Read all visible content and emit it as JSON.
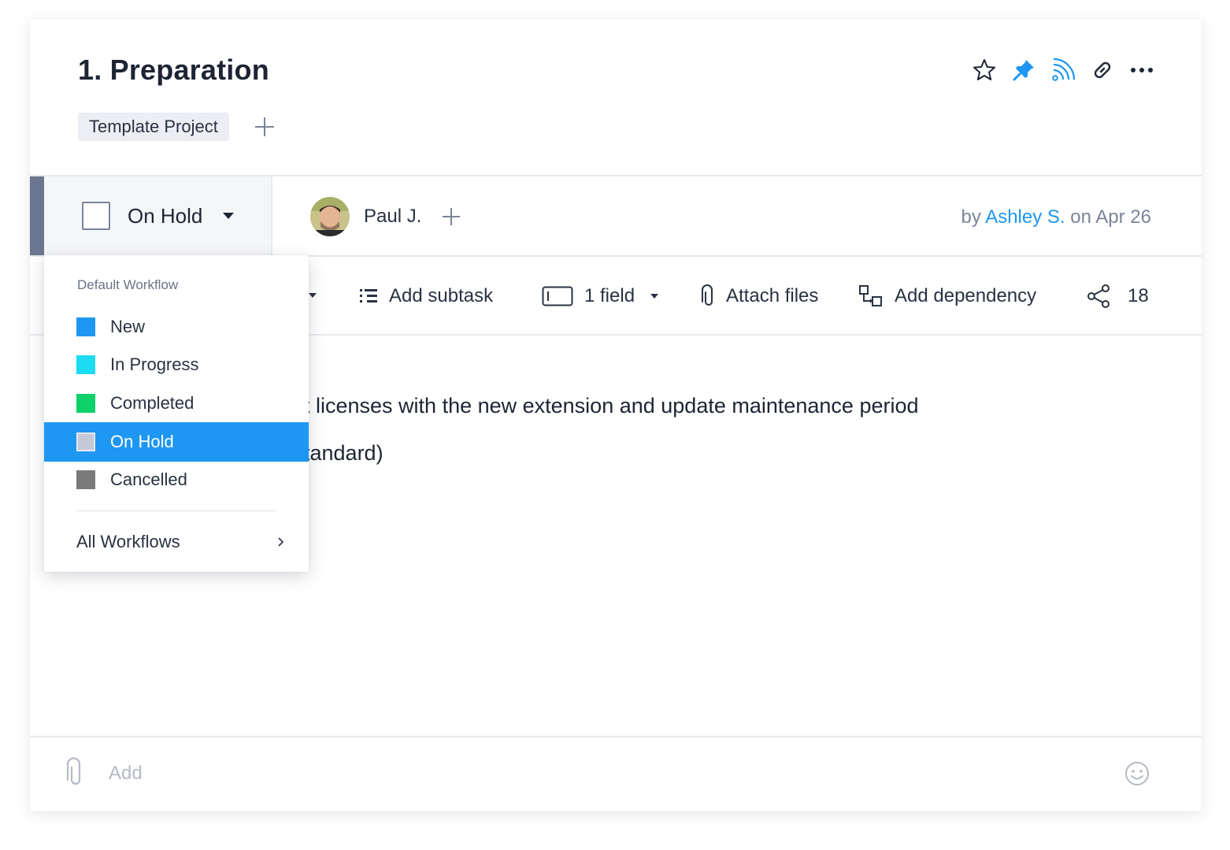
{
  "task": {
    "title": "1. Preparation",
    "tag": "Template Project"
  },
  "status": {
    "label": "On Hold",
    "bar_color": "#6b7790"
  },
  "assignee": {
    "name": "Paul J."
  },
  "byline": {
    "prefix": "by",
    "author": "Ashley S.",
    "date_text": "on Apr 26"
  },
  "toolbar": {
    "add_subtask": "Add subtask",
    "field": "1 field",
    "attach": "Attach files",
    "dependency": "Add dependency",
    "share_count": "18"
  },
  "description": {
    "line1": "t licenses with the new extension and update maintenance period",
    "line2": "tandard)"
  },
  "comment": {
    "placeholder": "Add"
  },
  "dropdown": {
    "heading": "Default Workflow",
    "items": [
      {
        "label": "New",
        "color": "#1e97f3",
        "active": false
      },
      {
        "label": "In Progress",
        "color": "#1ddcf2",
        "active": false
      },
      {
        "label": "Completed",
        "color": "#0fd16a",
        "active": false
      },
      {
        "label": "On Hold",
        "color": "#c3c9d8",
        "active": true
      },
      {
        "label": "Cancelled",
        "color": "#7a7a7a",
        "active": false
      }
    ],
    "all_workflows": "All Workflows"
  },
  "colors": {
    "accent": "#1e97f3",
    "text": "#1d2433"
  },
  "icons": [
    "star-icon",
    "pin-icon",
    "feed-icon",
    "link-icon",
    "more-icon",
    "subtask-icon",
    "field-icon",
    "paperclip-icon",
    "dependency-icon",
    "share-icon",
    "smile-icon"
  ]
}
